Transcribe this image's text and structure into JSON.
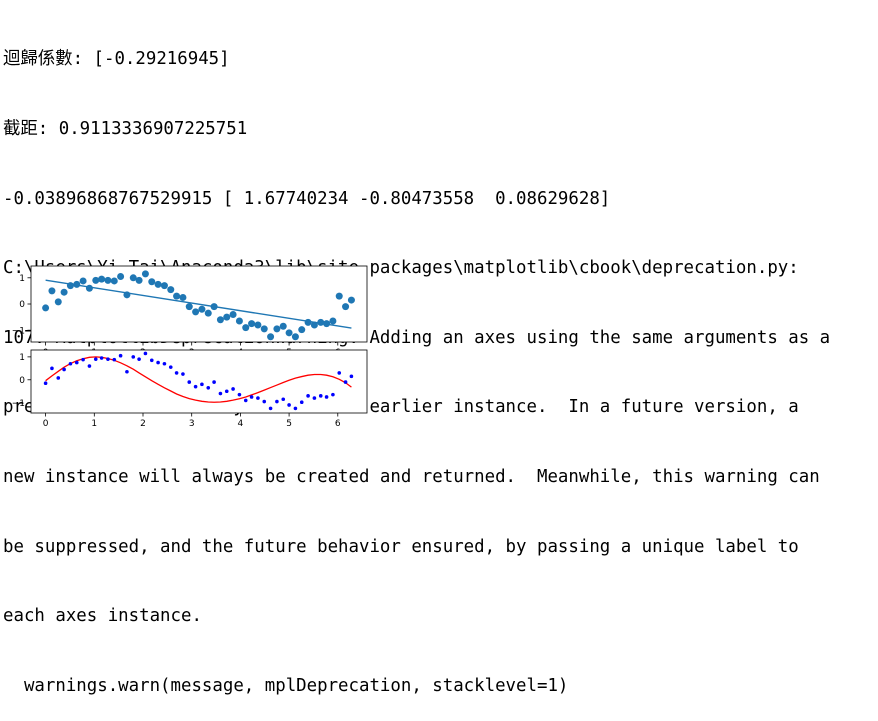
{
  "console": {
    "lines": [
      "迴歸係數: [-0.29216945]",
      "截距: 0.9113336907225751",
      "-0.03896868767529915 [ 1.67740234 -0.80473558  0.08629628]",
      "C:\\Users\\Yi Tai\\Anaconda3\\lib\\site-packages\\matplotlib\\cbook\\deprecation.py:",
      "107: MatplotlibDeprecationWarning: Adding an axes using the same arguments as a",
      "previous axes currently reuses the earlier instance.  In a future version, a",
      "new instance will always be created and returned.  Meanwhile, this warning can",
      "be suppressed, and the future behavior ensured, by passing a unique label to",
      "each axes instance.",
      "  warnings.warn(message, mplDeprecation, stacklevel=1)"
    ]
  },
  "colors": {
    "scatter_top": "#1f77b4",
    "fit_line_top": "#1f77b4",
    "points_bottom": "#0000ff",
    "curve_bottom": "#ff0000"
  },
  "chart_data": [
    {
      "type": "scatter",
      "title": "",
      "xlabel": "",
      "ylabel": "",
      "xlim": [
        -0.3,
        6.6
      ],
      "ylim": [
        -1.45,
        1.45
      ],
      "xticks": [
        0,
        1,
        2,
        3,
        4,
        5,
        6
      ],
      "yticks": [
        1,
        0,
        -1
      ],
      "grid": false,
      "series": [
        {
          "kind": "scatter",
          "x": [
            0.0,
            0.13,
            0.26,
            0.38,
            0.51,
            0.64,
            0.77,
            0.9,
            1.03,
            1.15,
            1.28,
            1.41,
            1.54,
            1.67,
            1.8,
            1.92,
            2.05,
            2.18,
            2.31,
            2.44,
            2.57,
            2.69,
            2.82,
            2.95,
            3.08,
            3.21,
            3.34,
            3.46,
            3.59,
            3.72,
            3.85,
            3.98,
            4.11,
            4.23,
            4.36,
            4.49,
            4.62,
            4.75,
            4.88,
            5.0,
            5.13,
            5.26,
            5.39,
            5.52,
            5.65,
            5.77,
            5.9,
            6.03,
            6.16,
            6.28
          ],
          "y": [
            -0.15,
            0.5,
            0.08,
            0.45,
            0.7,
            0.75,
            0.88,
            0.6,
            0.9,
            0.95,
            0.9,
            0.88,
            1.05,
            0.35,
            1.0,
            0.9,
            1.15,
            0.85,
            0.75,
            0.7,
            0.55,
            0.3,
            0.25,
            -0.1,
            -0.3,
            -0.2,
            -0.35,
            -0.1,
            -0.6,
            -0.5,
            -0.4,
            -0.65,
            -0.9,
            -0.75,
            -0.8,
            -0.95,
            -1.25,
            -0.95,
            -0.85,
            -1.1,
            -1.25,
            -0.98,
            -0.7,
            -0.8,
            -0.7,
            -0.75,
            -0.65,
            0.3,
            -0.1,
            0.15
          ]
        },
        {
          "kind": "line",
          "x": [
            0.0,
            6.28
          ],
          "y": [
            0.91,
            -0.92
          ]
        }
      ]
    },
    {
      "type": "scatter",
      "title": "",
      "xlabel": "",
      "ylabel": "",
      "xlim": [
        -0.3,
        6.6
      ],
      "ylim": [
        -1.45,
        1.3
      ],
      "xticks": [
        0,
        1,
        2,
        3,
        4,
        5,
        6
      ],
      "yticks": [
        1,
        0,
        -1
      ],
      "grid": false,
      "series": [
        {
          "kind": "scatter",
          "x": [
            0.0,
            0.13,
            0.26,
            0.38,
            0.51,
            0.64,
            0.77,
            0.9,
            1.03,
            1.15,
            1.28,
            1.41,
            1.54,
            1.67,
            1.8,
            1.92,
            2.05,
            2.18,
            2.31,
            2.44,
            2.57,
            2.69,
            2.82,
            2.95,
            3.08,
            3.21,
            3.34,
            3.46,
            3.59,
            3.72,
            3.85,
            3.98,
            4.11,
            4.23,
            4.36,
            4.49,
            4.62,
            4.75,
            4.88,
            5.0,
            5.13,
            5.26,
            5.39,
            5.52,
            5.65,
            5.77,
            5.9,
            6.03,
            6.16,
            6.28
          ],
          "y": [
            -0.15,
            0.5,
            0.08,
            0.45,
            0.7,
            0.75,
            0.88,
            0.6,
            0.9,
            0.95,
            0.9,
            0.88,
            1.05,
            0.35,
            1.0,
            0.9,
            1.15,
            0.85,
            0.75,
            0.7,
            0.55,
            0.3,
            0.25,
            -0.1,
            -0.3,
            -0.2,
            -0.35,
            -0.1,
            -0.6,
            -0.5,
            -0.4,
            -0.65,
            -0.9,
            -0.75,
            -0.8,
            -0.95,
            -1.25,
            -0.95,
            -0.85,
            -1.1,
            -1.25,
            -0.98,
            -0.7,
            -0.8,
            -0.7,
            -0.75,
            -0.65,
            0.3,
            -0.1,
            0.15
          ]
        },
        {
          "kind": "line",
          "x": [
            0.0,
            0.13,
            0.26,
            0.38,
            0.51,
            0.64,
            0.77,
            0.9,
            1.03,
            1.15,
            1.28,
            1.41,
            1.54,
            1.67,
            1.8,
            1.92,
            2.05,
            2.18,
            2.31,
            2.44,
            2.57,
            2.69,
            2.82,
            2.95,
            3.08,
            3.21,
            3.34,
            3.46,
            3.59,
            3.72,
            3.85,
            3.98,
            4.11,
            4.23,
            4.36,
            4.49,
            4.62,
            4.75,
            4.88,
            5.0,
            5.13,
            5.26,
            5.39,
            5.52,
            5.65,
            5.77,
            5.9,
            6.03,
            6.16,
            6.28
          ],
          "y": [
            -0.04,
            0.17,
            0.37,
            0.55,
            0.71,
            0.83,
            0.92,
            0.98,
            1.0,
            0.98,
            0.93,
            0.85,
            0.74,
            0.61,
            0.46,
            0.3,
            0.13,
            -0.04,
            -0.2,
            -0.35,
            -0.49,
            -0.62,
            -0.73,
            -0.82,
            -0.89,
            -0.94,
            -0.97,
            -0.98,
            -0.97,
            -0.94,
            -0.89,
            -0.83,
            -0.75,
            -0.66,
            -0.56,
            -0.45,
            -0.34,
            -0.23,
            -0.12,
            -0.02,
            0.07,
            0.14,
            0.2,
            0.23,
            0.23,
            0.2,
            0.13,
            0.02,
            -0.13,
            -0.32
          ]
        }
      ]
    }
  ]
}
